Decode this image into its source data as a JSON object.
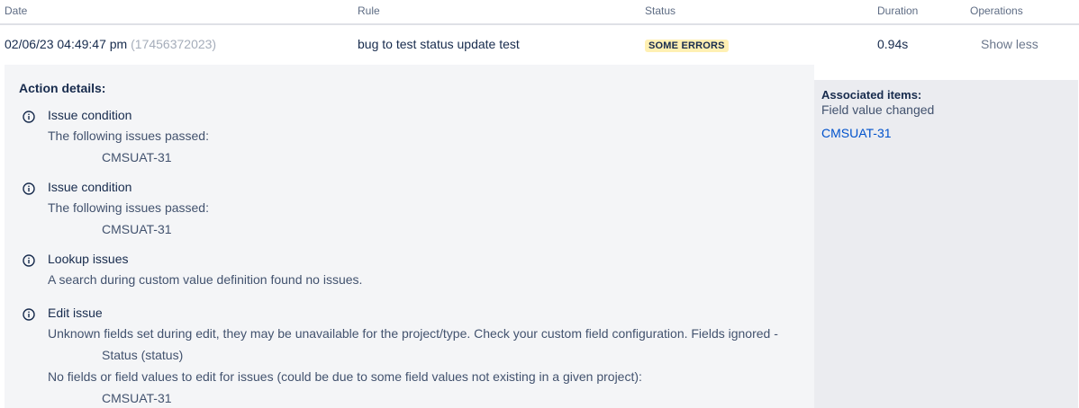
{
  "table": {
    "headers": {
      "date": "Date",
      "rule": "Rule",
      "status": "Status",
      "duration": "Duration",
      "operations": "Operations"
    },
    "row": {
      "date": "02/06/23 04:49:47 pm",
      "id": "(17456372023)",
      "rule": "bug to test status update test",
      "status": "SOME ERRORS",
      "duration": "0.94s",
      "operation": "Show less"
    }
  },
  "details": {
    "title": "Action details:",
    "actions": [
      {
        "name": "Issue condition",
        "lines": [
          "The following issues passed:",
          "CMSUAT-31"
        ]
      },
      {
        "name": "Issue condition",
        "lines": [
          "The following issues passed:",
          "CMSUAT-31"
        ]
      },
      {
        "name": "Lookup issues",
        "lines": [
          "A search during custom value definition found no issues."
        ]
      },
      {
        "name": "Edit issue",
        "lines": [
          "Unknown fields set during edit, they may be unavailable for the project/type. Check your custom field configuration. Fields ignored -",
          "Status (status)",
          "No fields or field values to edit for issues (could be due to some field values not existing in a given project):",
          "CMSUAT-31"
        ]
      }
    ]
  },
  "associated": {
    "label": "Associated items:",
    "value": "Field value changed",
    "link": "CMSUAT-31"
  },
  "icons": {
    "info": "info-icon"
  },
  "colors": {
    "status_badge_bg": "#fff0b3",
    "link": "#0052cc"
  }
}
